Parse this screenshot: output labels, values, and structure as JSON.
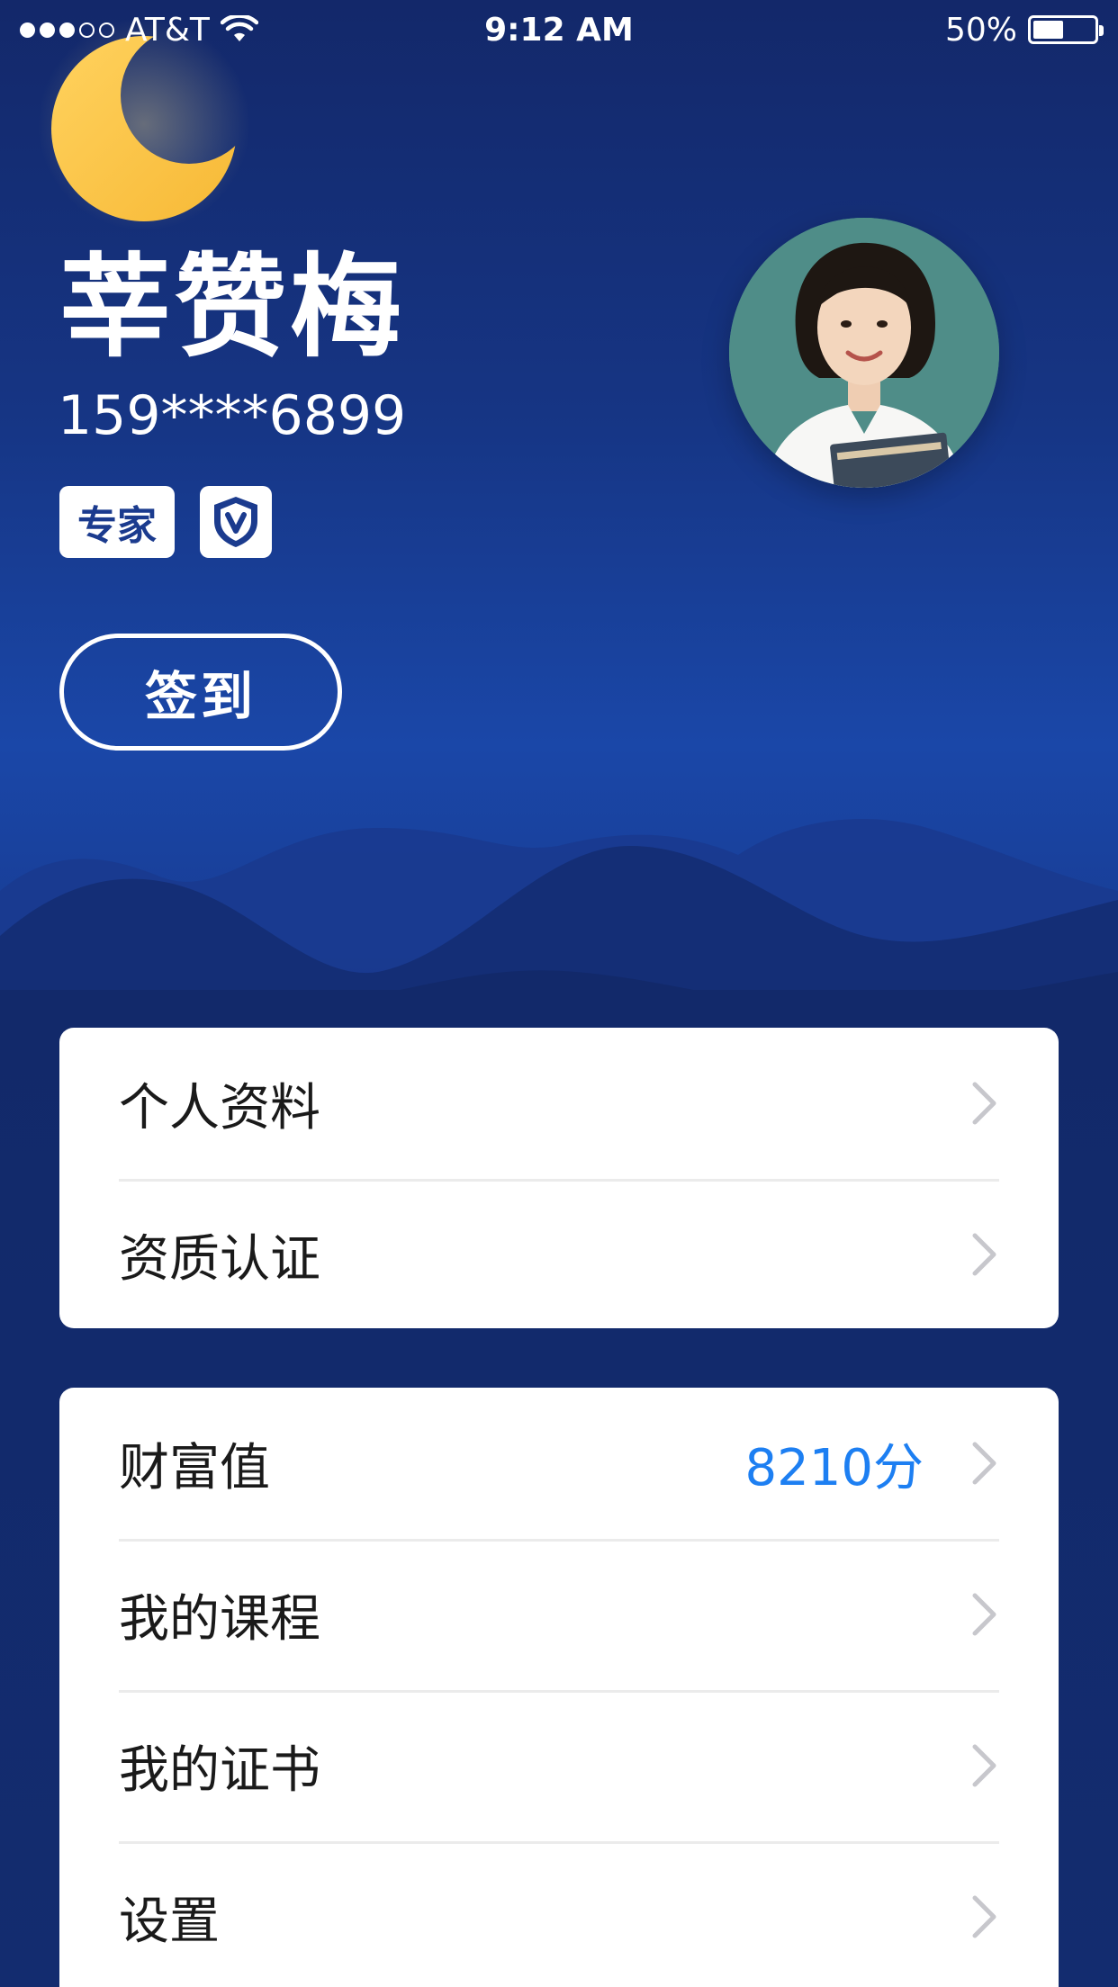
{
  "status_bar": {
    "carrier": "AT&T",
    "time": "9:12 AM",
    "battery_percent": "50%",
    "battery_level": 0.5,
    "signal_bars_filled": 3,
    "signal_bars_total": 5
  },
  "profile": {
    "name": "莘赞梅",
    "phone": "159****6899",
    "badge_expert": "专家",
    "checkin_label": "签到"
  },
  "menu_group1": [
    {
      "label": "个人资料"
    },
    {
      "label": "资质认证"
    }
  ],
  "menu_group2": [
    {
      "label": "财富值",
      "value": "8210分"
    },
    {
      "label": "我的课程"
    },
    {
      "label": "我的证书"
    },
    {
      "label": "设置"
    }
  ],
  "icons": {
    "moon": "moon-icon",
    "verified": "shield-verified-icon",
    "chevron": "chevron-right-icon",
    "wifi": "wifi-icon",
    "battery": "battery-icon"
  },
  "colors": {
    "background": "#122a6a",
    "accent_value": "#1d7ff2",
    "badge_text": "#1b3b8e"
  }
}
